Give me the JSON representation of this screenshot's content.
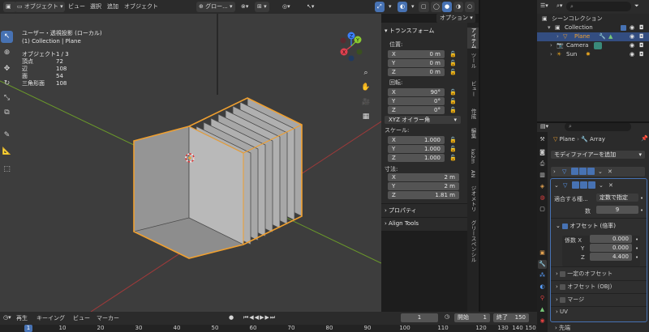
{
  "header": {
    "mode": "オブジェクト",
    "menus": [
      "ビュー",
      "選択",
      "追加",
      "オブジェクト"
    ],
    "orientation": "グロー...",
    "options_label": "オプション"
  },
  "viewport": {
    "title": "ユーザー・透視投影 (ローカル)",
    "collection": "(1) Collection | Plane",
    "stats": [
      {
        "label": "オブジェクト",
        "value": "1 / 3"
      },
      {
        "label": "頂点",
        "value": "72"
      },
      {
        "label": "辺",
        "value": "108"
      },
      {
        "label": "面",
        "value": "54"
      },
      {
        "label": "三角形面",
        "value": "108"
      }
    ],
    "gizmo_axes": [
      "Z",
      "Y",
      "X"
    ]
  },
  "npanel": {
    "transform_title": "トランスフォーム",
    "location_label": "位置:",
    "location": [
      {
        "axis": "X",
        "value": "0 m"
      },
      {
        "axis": "Y",
        "value": "0 m"
      },
      {
        "axis": "Z",
        "value": "0 m"
      }
    ],
    "rotation_label": "回転:",
    "rotation": [
      {
        "axis": "X",
        "value": "90°"
      },
      {
        "axis": "Y",
        "value": "0°"
      },
      {
        "axis": "Z",
        "value": "0°"
      }
    ],
    "rotation_mode": "XYZ オイラー角",
    "scale_label": "スケール:",
    "scale": [
      {
        "axis": "X",
        "value": "1.000"
      },
      {
        "axis": "Y",
        "value": "1.000"
      },
      {
        "axis": "Z",
        "value": "1.000"
      }
    ],
    "dimensions_label": "寸法:",
    "dimensions": [
      {
        "axis": "X",
        "value": "2 m"
      },
      {
        "axis": "Y",
        "value": "2 m"
      },
      {
        "axis": "Z",
        "value": "1.81 m"
      }
    ],
    "properties_section": "プロパティ",
    "align_tools_section": "Align Tools",
    "tabs": [
      "アイテム",
      "ツール",
      "ビュー",
      "作成",
      "編集",
      "ke2m",
      "AN",
      "ジオメトリ",
      "グリースペンシル"
    ]
  },
  "timeline": {
    "menus": [
      "再生",
      "キーイング",
      "ビュー",
      "マーカー"
    ],
    "current_frame": "1",
    "start_label": "開始",
    "start": "1",
    "end_label": "終了",
    "end": "150",
    "ticks": [
      "1",
      "10",
      "20",
      "30",
      "40",
      "50",
      "60",
      "70",
      "80",
      "90",
      "100",
      "110",
      "120",
      "130",
      "140",
      "150"
    ]
  },
  "outliner": {
    "root": "シーンコレクション",
    "rows": [
      {
        "name": "Collection"
      },
      {
        "name": "Plane"
      },
      {
        "name": "Camera"
      },
      {
        "name": "Sun"
      }
    ]
  },
  "properties": {
    "breadcrumb_object": "Plane",
    "breadcrumb_modifier": "Array",
    "add_modifier": "モディファイアーを追加",
    "fit_type_label": "適合する種...",
    "fit_type_value": "定数で指定",
    "count_label": "数",
    "count_value": "9",
    "relative_offset_label": "オフセット (倍率)",
    "factor_x_label": "係数 X",
    "factor_x": "0.000",
    "factor_y_label": "Y",
    "factor_y": "0.000",
    "factor_z_label": "Z",
    "factor_z": "4.400",
    "constant_offset": "一定のオフセット",
    "object_offset": "オフセット (OBJ)",
    "merge": "マージ",
    "uv": "UV",
    "caps": "先端"
  },
  "colors": {
    "accent": "#4772b3",
    "selection": "#f0a030",
    "background": "#1d1d1d",
    "viewport": "#3d3d3d",
    "x_axis": "#e0404f",
    "y_axis": "#8acc30",
    "z_axis": "#3a80ff"
  }
}
